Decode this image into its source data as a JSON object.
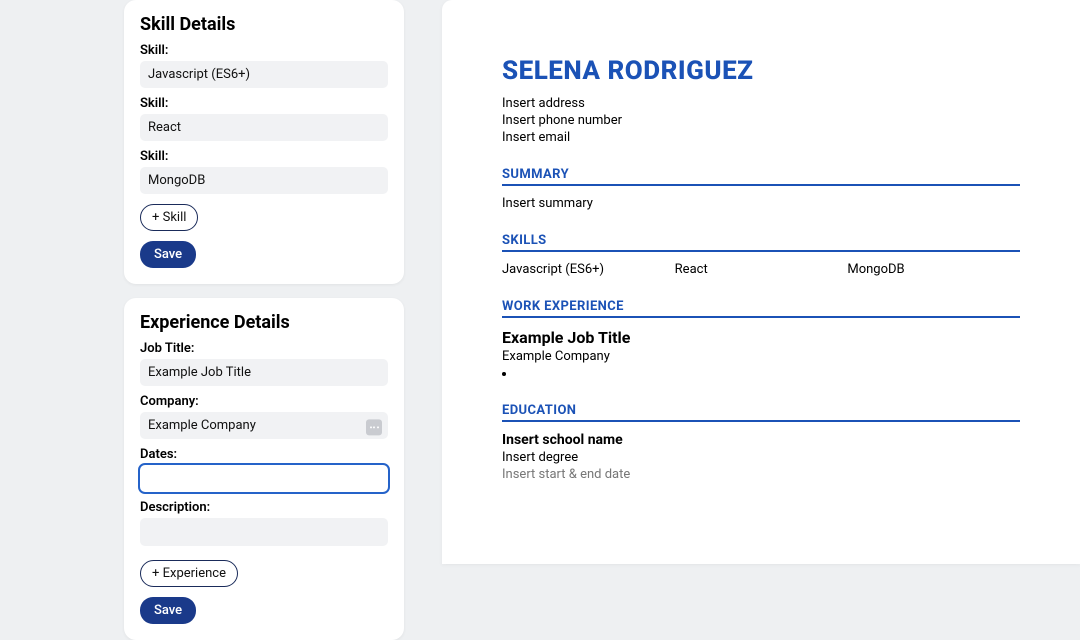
{
  "skillCard": {
    "title": "Skill Details",
    "skillLabel": "Skill:",
    "skills": [
      "Javascript (ES6+)",
      "React",
      "MongoDB"
    ],
    "addBtn": "+ Skill",
    "saveBtn": "Save"
  },
  "expCard": {
    "title": "Experience Details",
    "jobTitleLabel": "Job Title:",
    "jobTitle": "Example Job Title",
    "companyLabel": "Company:",
    "company": "Example Company",
    "datesLabel": "Dates:",
    "dates": "",
    "descLabel": "Description:",
    "desc": "",
    "addBtn": "+ Experience",
    "saveBtn": "Save"
  },
  "resume": {
    "name": "SELENA RODRIGUEZ",
    "contact": {
      "address": "Insert address",
      "phone": "Insert phone number",
      "email": "Insert email"
    },
    "sections": {
      "summaryHead": "SUMMARY",
      "summaryText": "Insert summary",
      "skillsHead": "SKILLS",
      "skills": [
        "Javascript (ES6+)",
        "React",
        "MongoDB"
      ],
      "workHead": "WORK EXPERIENCE",
      "job": {
        "title": "Example Job Title",
        "company": "Example Company"
      },
      "eduHead": "EDUCATION",
      "edu": {
        "school": "Insert school name",
        "degree": "Insert degree",
        "dates": "Insert start & end date"
      }
    }
  }
}
